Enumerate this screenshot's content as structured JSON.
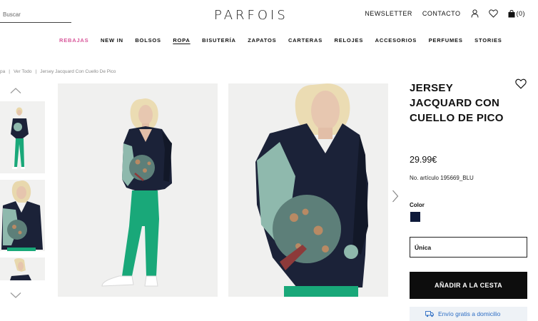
{
  "header": {
    "search_placeholder": "Buscar",
    "logo": "PARFOIS",
    "newsletter": "NEWSLETTER",
    "contact": "CONTACTO",
    "bag_count": "(0)"
  },
  "nav": [
    {
      "label": "REBAJAS"
    },
    {
      "label": "NEW IN"
    },
    {
      "label": "BOLSOS"
    },
    {
      "label": "ROPA"
    },
    {
      "label": "BISUTERÍA"
    },
    {
      "label": "ZAPATOS"
    },
    {
      "label": "CARTERAS"
    },
    {
      "label": "RELOJES"
    },
    {
      "label": "ACCESORIOS"
    },
    {
      "label": "PERFUMES"
    },
    {
      "label": "STORIES"
    }
  ],
  "breadcrumb": {
    "item1": "pa",
    "item2": "Ver Todo",
    "item3": "Jersey Jacquard Con Cuello De Pico"
  },
  "product": {
    "title": "JERSEY JACQUARD CON CUELLO DE PICO",
    "price": "29.99€",
    "sku": "No. artículo 195669_BLU",
    "color_label": "Color",
    "size": "Única",
    "add_to_cart": "AÑADIR A LA CESTA",
    "shipping": "Envío gratis a domicilio"
  },
  "colors": {
    "sale": "#d8579a",
    "swatch_navy": "#0e1a3a",
    "button_black": "#0d0d0d",
    "shipping_blue": "#2b6cc4",
    "sweater_navy": "#1b2238",
    "sweater_teal": "#8fb9ad",
    "pants_green": "#19a879"
  },
  "icons": [
    "user-icon",
    "heart-icon",
    "bag-icon",
    "chevron-up-icon",
    "chevron-down-icon",
    "chevron-right-icon",
    "truck-icon"
  ]
}
